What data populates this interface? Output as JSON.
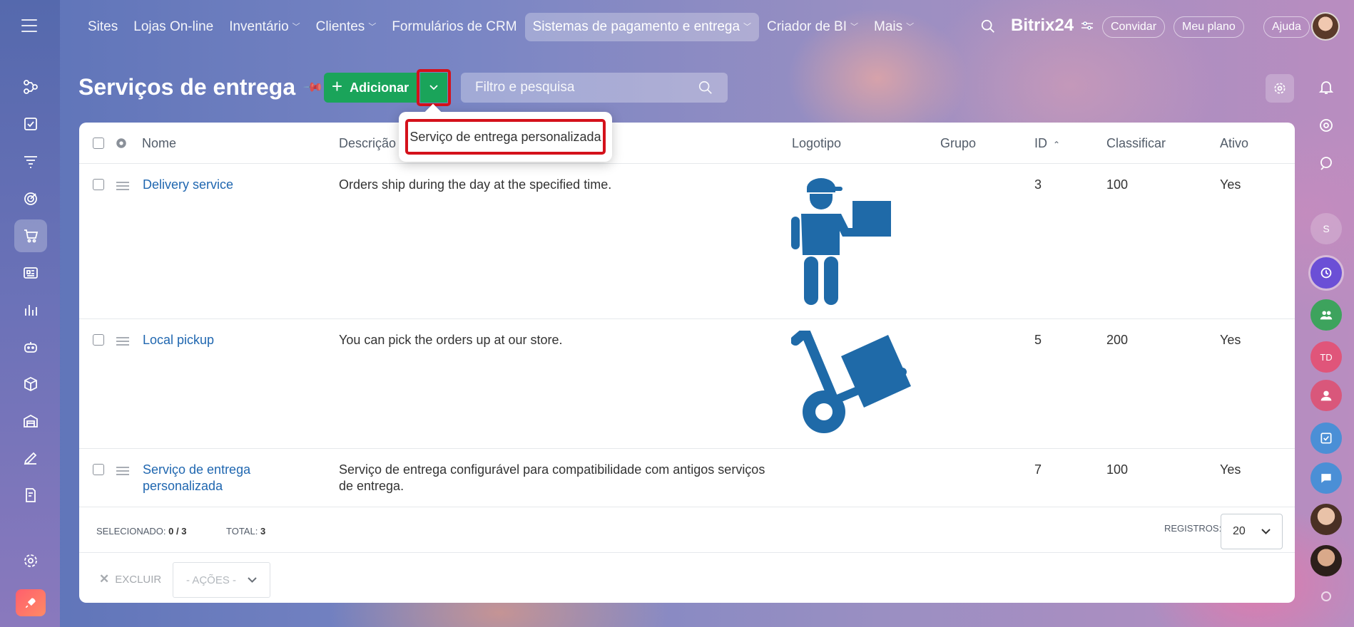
{
  "nav": {
    "items": [
      {
        "label": "Sites",
        "dropdown": false,
        "active": false
      },
      {
        "label": "Lojas On-line",
        "dropdown": false,
        "active": false
      },
      {
        "label": "Inventário",
        "dropdown": true,
        "active": false
      },
      {
        "label": "Clientes",
        "dropdown": true,
        "active": false
      },
      {
        "label": "Formulários de CRM",
        "dropdown": false,
        "active": false
      },
      {
        "label": "Sistemas de pagamento e entrega",
        "dropdown": true,
        "active": true
      },
      {
        "label": "Criador de BI",
        "dropdown": true,
        "active": false
      },
      {
        "label": "Mais",
        "dropdown": true,
        "active": false
      }
    ],
    "brand": "Bitrix24",
    "invite": "Convidar",
    "plan": "Meu plano",
    "help": "Ajuda"
  },
  "right_rail": {
    "avatar_s": "S",
    "avatar_td": "TD"
  },
  "page": {
    "title": "Serviços de entrega",
    "add_label": "Adicionar",
    "filter_placeholder": "Filtro e pesquisa"
  },
  "dropdown": {
    "item": "Serviço de entrega personalizada"
  },
  "table": {
    "columns": {
      "name": "Nome",
      "description": "Descrição",
      "logo": "Logotipo",
      "group": "Grupo",
      "id": "ID",
      "sort": "Classificar",
      "active": "Ativo"
    },
    "rows": [
      {
        "name": "Delivery service",
        "description": "Orders ship during the day at the specified time.",
        "logo": "delivery-man-icon",
        "group": "",
        "id": "3",
        "sort": "100",
        "active": "Yes"
      },
      {
        "name": "Local pickup",
        "description": "You can pick the orders up at our store.",
        "logo": "hand-truck-icon",
        "group": "",
        "id": "5",
        "sort": "200",
        "active": "Yes"
      },
      {
        "name_line1": "Serviço de entrega",
        "name_line2": "personalizada",
        "description_line1": "Serviço de entrega configurável para compatibilidade com antigos serviços",
        "description_line2": "de entrega.",
        "logo": "",
        "group": "",
        "id": "7",
        "sort": "100",
        "active": "Yes"
      }
    ]
  },
  "footer": {
    "selected_label": "SELECIONADO:",
    "selected_value": "0 / 3",
    "total_label": "TOTAL:",
    "total_value": "3",
    "records_label": "REGISTROS:",
    "records_value": "20",
    "delete_label": "EXCLUIR",
    "actions_label": "- AÇÕES -"
  },
  "colors": {
    "accent_green": "#1aa45a",
    "link_blue": "#2067b0",
    "highlight_red": "#d4111b",
    "logo_blue": "#1f6aa8"
  }
}
